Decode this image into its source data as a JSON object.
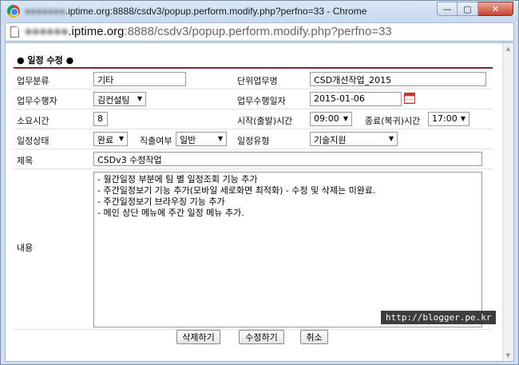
{
  "window": {
    "title_blurred": "●●●●●●●",
    "title": ".iptime.org:8888/csdv3/popup.perform.modify.php?perfno=33 - Chrome",
    "min_label": "—",
    "max_label": "▢",
    "close_label": "✕"
  },
  "address": {
    "host_blurred": "●●●●●●",
    "host": ".iptime.org",
    "rest": ":8888/csdv3/popup.perform.modify.php?perfno=33"
  },
  "page": {
    "section_title": "● 일정 수정 ●"
  },
  "form": {
    "category_label": "업무분류",
    "category_value": "기타",
    "unit_task_label": "단위업무명",
    "unit_task_value": "CSD개선작업_2015",
    "performer_label": "업무수행자",
    "performer_value": "김컨설팅",
    "perform_date_label": "업무수행일자",
    "perform_date_value": "2015-01-06",
    "hours_label": "소요시간",
    "hours_value": "8",
    "start_time_label": "시작(출발)시간",
    "start_time_value": "09:00",
    "end_time_label": "종료(복귀)시간",
    "end_time_value": "17:00",
    "status_label": "일정상태",
    "status_value": "완료",
    "direct_label": "직출여부",
    "direct_value": "일반",
    "type_label": "일정유형",
    "type_value": "기술지원",
    "subject_label": "제목",
    "subject_value": "CSDv3 수정작업",
    "content_label": "내용",
    "content_value": "- 월간일정 부분에 팀 별 일정조회 기능 추가\n- 주간일정보기 기능 추가(모바일 세로화면 최적화) - 수정 및 삭제는 미완료.\n- 주간일정보기 브라우징 기능 추가\n- 메인 상단 메뉴에 주간 일정 메뉴 추가."
  },
  "buttons": {
    "delete_label": "삭제하기",
    "modify_label": "수정하기",
    "cancel_label": "취소"
  },
  "watermark": "http://blogger.pe.kr"
}
